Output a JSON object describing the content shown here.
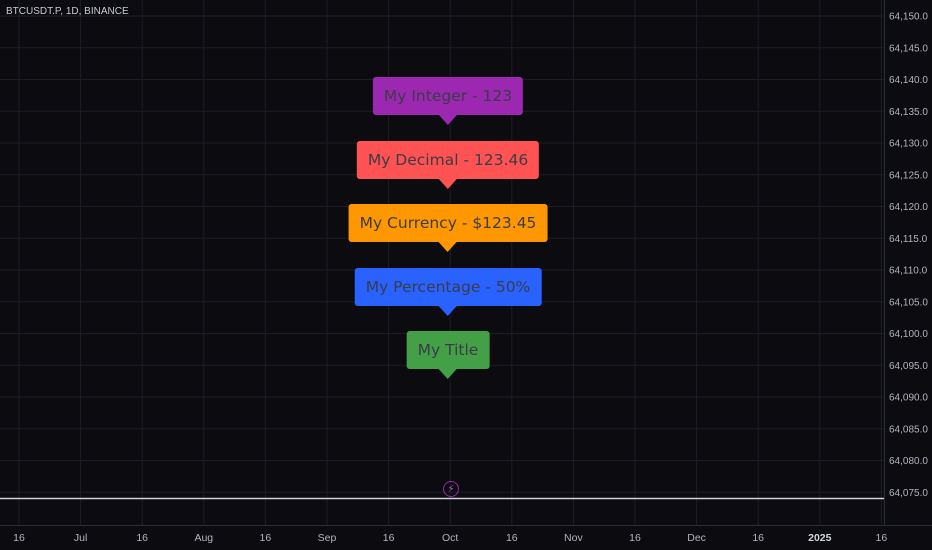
{
  "header": {
    "symbol": "BTCUSDT.P, 1D, BINANCE"
  },
  "price_axis": {
    "ticks": [
      "64,150.0",
      "64,145.0",
      "64,140.0",
      "64,135.0",
      "64,130.0",
      "64,125.0",
      "64,120.0",
      "64,115.0",
      "64,110.0",
      "64,105.0",
      "64,100.0",
      "64,095.0",
      "64,090.0",
      "64,085.0",
      "64,080.0",
      "64,075.0"
    ]
  },
  "time_axis": {
    "ticks": [
      "16",
      "Jul",
      "16",
      "Aug",
      "16",
      "Sep",
      "16",
      "Oct",
      "16",
      "Nov",
      "16",
      "Dec",
      "16",
      "2025",
      "16"
    ],
    "bold": [
      "2025"
    ]
  },
  "labels": [
    {
      "text": "My Integer - 123",
      "color": "#9c27b0"
    },
    {
      "text": "My Decimal - 123.46",
      "color": "#ff5252"
    },
    {
      "text": "My Currency - $123.45",
      "color": "#ff9800"
    },
    {
      "text": "My Percentage - 50%",
      "color": "#2962ff"
    },
    {
      "text": "My Title",
      "color": "#43a047"
    }
  ],
  "icons": {
    "event_marker": "lightning-icon"
  },
  "colors": {
    "background": "#0b0b10",
    "grid": "#1c1e26",
    "axis_text": "#b2b5be",
    "baseline": "#d1d4dc"
  }
}
